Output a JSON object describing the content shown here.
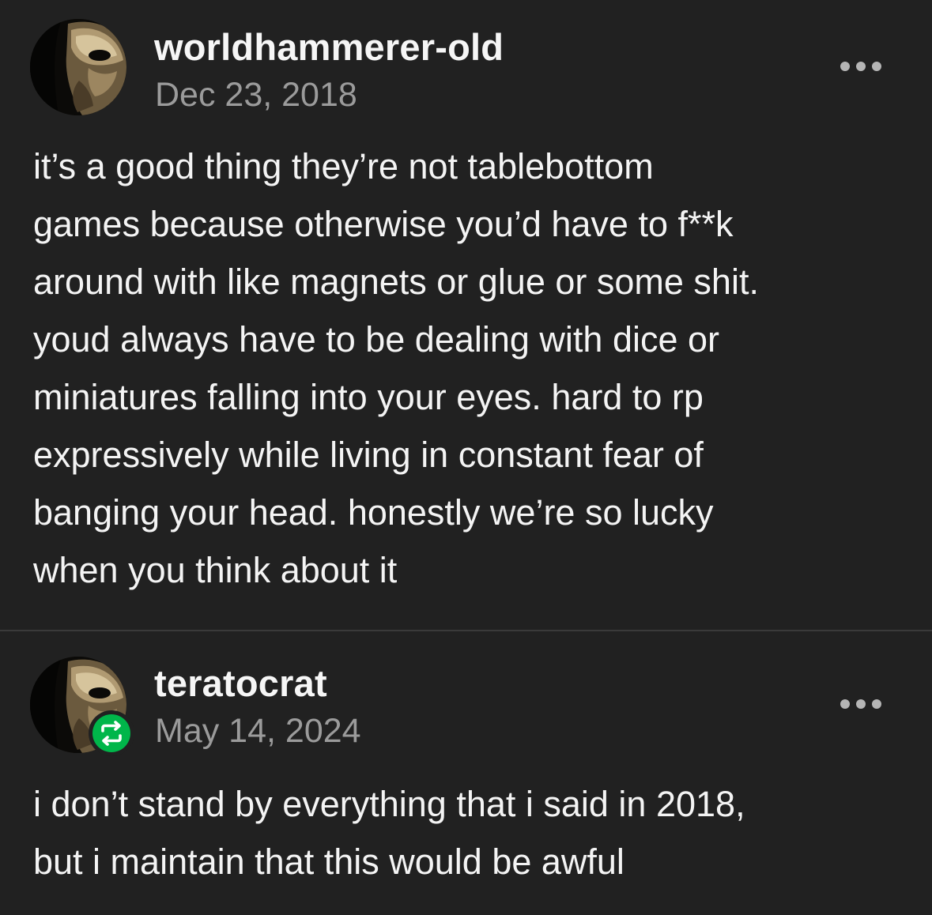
{
  "posts": [
    {
      "username": "worldhammerer-old",
      "date": "Dec 23, 2018",
      "avatar_icon": "venetian-mask-avatar",
      "more_icon": "more-options-icon",
      "body": "it’s a good thing they’re not tablebottom\ngames because otherwise you’d have to f**k\naround with like magnets or glue or some shit.\nyoud always have to be dealing with dice or\nminiatures falling into your eyes. hard to rp\nexpressively while living in constant fear of\nbanging your head. honestly we’re so lucky\nwhen you think about it"
    },
    {
      "username": "teratocrat",
      "date": "May 14, 2024",
      "avatar_icon": "venetian-mask-avatar",
      "badge_icon": "reblog-icon",
      "more_icon": "more-options-icon",
      "body": "i don’t stand by everything that i said in 2018,\nbut i maintain that this would be awful"
    }
  ],
  "colors": {
    "background": "#212121",
    "text": "#f4f4f4",
    "date": "#9b9b9b",
    "divider": "#3a3a3a",
    "reblog_badge": "#00b64a"
  }
}
